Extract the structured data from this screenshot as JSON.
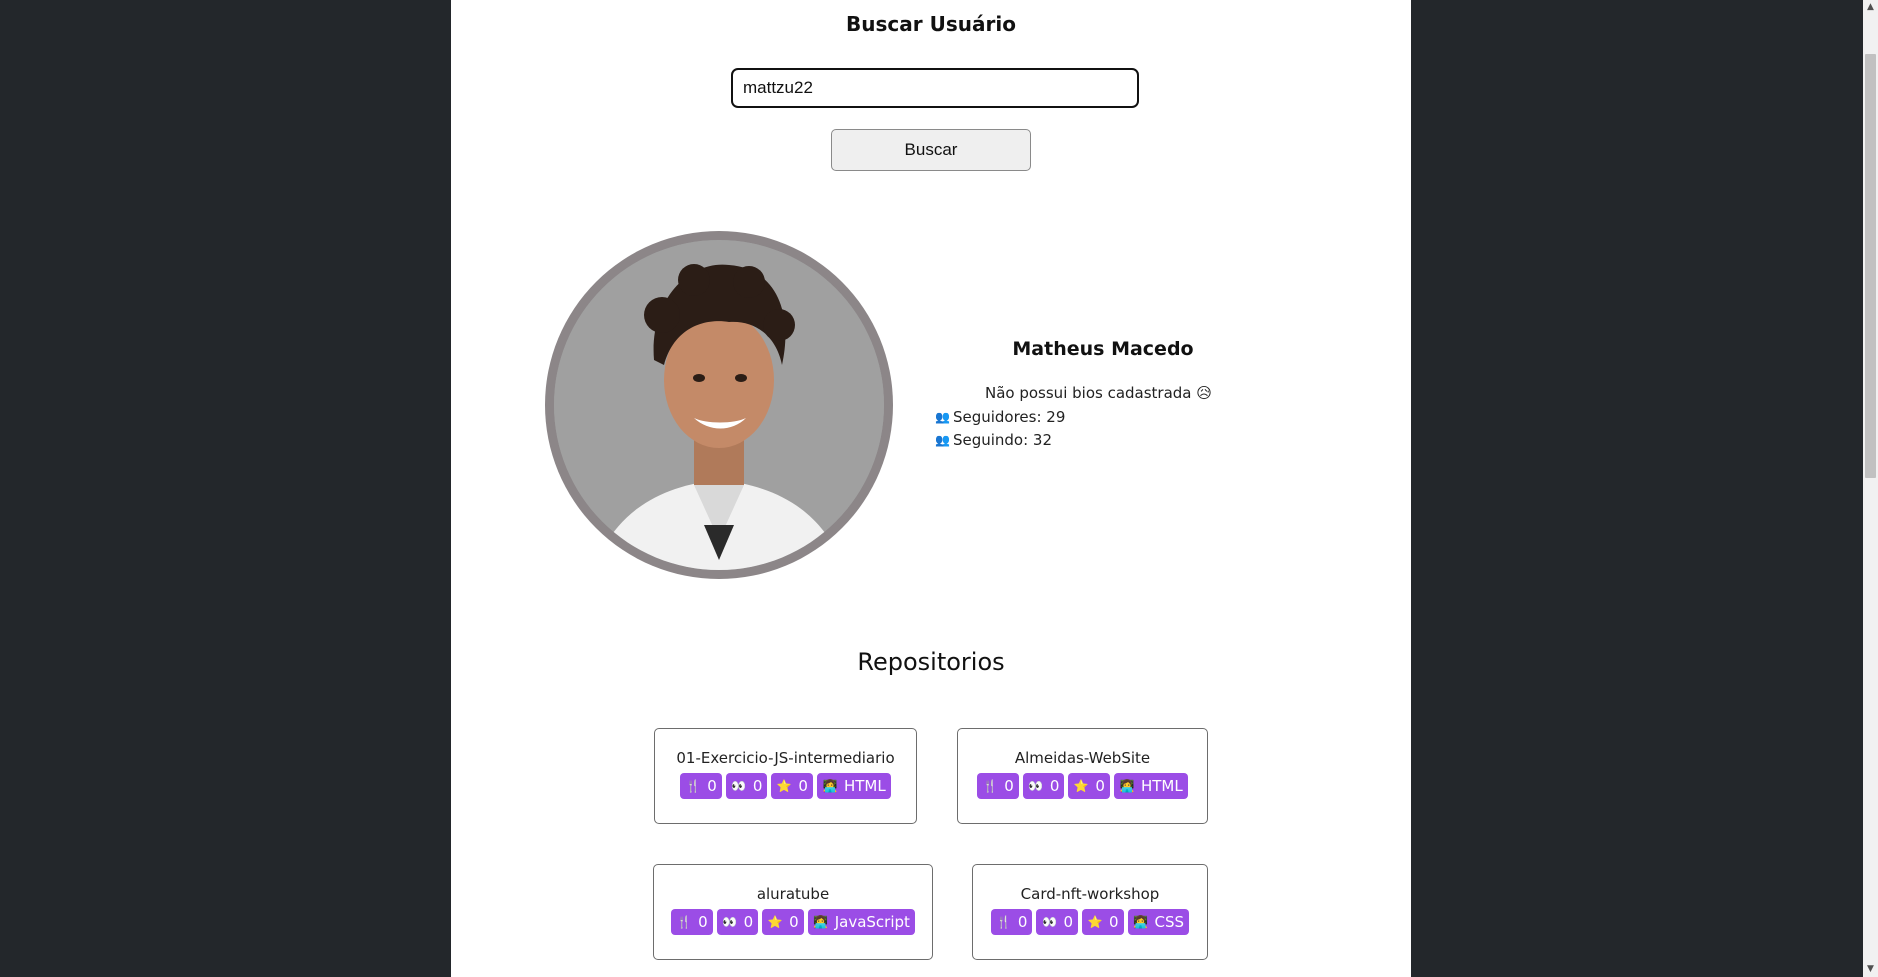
{
  "search": {
    "title": "Buscar Usuário",
    "input_value": "mattzu22",
    "button_label": "Buscar"
  },
  "profile": {
    "name": "Matheus Macedo",
    "bio": "Não possui bios cadastrada 😥",
    "followers_label": "Seguidores: 29",
    "following_label": "Seguindo: 32",
    "stat_icon": "👥"
  },
  "repositories": {
    "title": "Repositorios",
    "items": [
      {
        "name": "01-Exercicio-JS-intermediario",
        "forks": "0",
        "watchers": "0",
        "stars": "0",
        "language": "HTML"
      },
      {
        "name": "Almeidas-WebSite",
        "forks": "0",
        "watchers": "0",
        "stars": "0",
        "language": "HTML"
      },
      {
        "name": "aluratube",
        "forks": "0",
        "watchers": "0",
        "stars": "0",
        "language": "JavaScript"
      },
      {
        "name": "Card-nft-workshop",
        "forks": "0",
        "watchers": "0",
        "stars": "0",
        "language": "CSS"
      }
    ],
    "badge_icons": {
      "forks": "🍴",
      "watchers": "👀",
      "stars": "⭐",
      "language": "👩‍💻"
    }
  },
  "colors": {
    "background": "#23272b",
    "page": "#ffffff",
    "badge": "#9b4de6",
    "avatar_ring": "#8c8688"
  }
}
